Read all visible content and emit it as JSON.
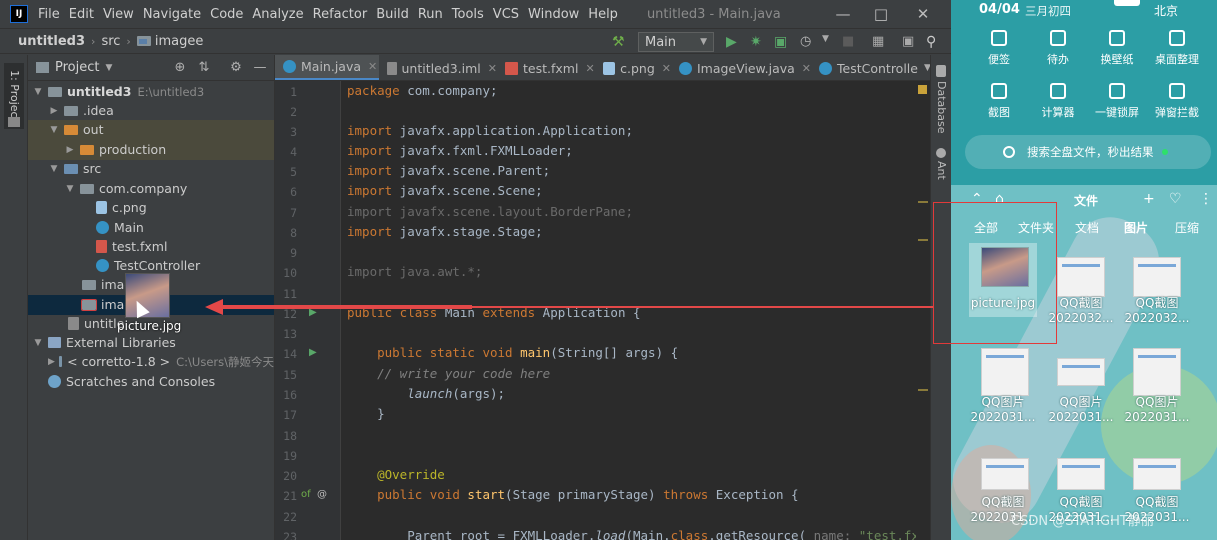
{
  "ide": {
    "logo": "IJ",
    "menu": [
      "File",
      "Edit",
      "View",
      "Navigate",
      "Code",
      "Analyze",
      "Refactor",
      "Build",
      "Run",
      "Tools",
      "VCS",
      "Window",
      "Help"
    ],
    "window_title": "untitled3 - Main.java",
    "breadcrumb": {
      "project": "untitled3",
      "src": "src",
      "folder": "imagee"
    },
    "run_config": "Main",
    "project_panel": {
      "title": "Project",
      "strip_label": "1: Project",
      "tree": [
        {
          "label": "untitled3",
          "path": "E:\\untitled3",
          "bold": true
        },
        {
          "label": ".idea"
        },
        {
          "label": "out"
        },
        {
          "label": "production"
        },
        {
          "label": "src"
        },
        {
          "label": "com.company"
        },
        {
          "label": "c.png"
        },
        {
          "label": "Main"
        },
        {
          "label": "test.fxml"
        },
        {
          "label": "TestController"
        },
        {
          "label": "image"
        },
        {
          "label": "imag"
        },
        {
          "label": "untitle"
        },
        {
          "label": "External Libraries"
        },
        {
          "label": "< corretto-1.8 >",
          "path": "C:\\Users\\静姬今天"
        },
        {
          "label": "Scratches and Consoles"
        }
      ],
      "drag_label": "picture.jpg"
    },
    "tabs": [
      "Main.java",
      "untitled3.iml",
      "test.fxml",
      "c.png",
      "ImageView.java",
      "TestControlle"
    ],
    "right_strip": [
      "Database",
      "Ant"
    ],
    "gutter_marks": {
      "overridden": "of",
      "annotation": "@"
    },
    "line_numbers": [
      "1",
      "2",
      "3",
      "4",
      "5",
      "6",
      "7",
      "8",
      "9",
      "10",
      "11",
      "12",
      "13",
      "14",
      "15",
      "16",
      "17",
      "18",
      "19",
      "20",
      "21",
      "22",
      "23"
    ],
    "code": {
      "l1": [
        "package",
        " com.company;"
      ],
      "l3": [
        "import",
        " javafx.application.Application;"
      ],
      "l4": [
        "import",
        " javafx.fxml.FXMLLoader;"
      ],
      "l5": [
        "import",
        " javafx.scene.Parent;"
      ],
      "l6": [
        "import",
        " javafx.scene.Scene;"
      ],
      "l7": "import javafx.scene.layout.BorderPane;",
      "l8": [
        "import",
        " javafx.stage.Stage;"
      ],
      "l10": "import java.awt.*;",
      "l12": [
        "public class",
        " Main ",
        "extends",
        " Application {"
      ],
      "l14": [
        "    public static void",
        " main",
        "(String[] args) {"
      ],
      "l15": "    // write your code here",
      "l16": [
        "        ",
        "launch",
        "(args);"
      ],
      "l17": "    }",
      "l20": "    @Override",
      "l21": [
        "    public void",
        " start",
        "(Stage primaryStage) ",
        "throws",
        " Exception {"
      ],
      "l23": [
        "        Parent root = FXMLLoader.",
        "load",
        "(Main.",
        "class",
        ".getResource( ",
        "name: ",
        "\"test.fx"
      ]
    }
  },
  "desktop": {
    "date": "04/04",
    "lunar": "三月初四",
    "city": "北京",
    "tiles": [
      "便签",
      "待办",
      "换壁纸",
      "桌面整理",
      "截图",
      "计算器",
      "一键锁屏",
      "弹窗拦截"
    ],
    "search_placeholder": "搜索全盘文件，秒出结果",
    "file_panel": {
      "title": "文件",
      "categories": [
        "全部",
        "文件夹",
        "文档",
        "图片",
        "压缩"
      ],
      "active_category": "图片",
      "files": [
        {
          "name1": "picture.jpg",
          "name2": ""
        },
        {
          "name1": "QQ截图",
          "name2": "2022032..."
        },
        {
          "name1": "QQ截图",
          "name2": "2022032..."
        },
        {
          "name1": "QQ图片",
          "name2": "2022031..."
        },
        {
          "name1": "QQ图片",
          "name2": "2022031..."
        },
        {
          "name1": "QQ图片",
          "name2": "2022031..."
        },
        {
          "name1": "QQ截图",
          "name2": "2022031..."
        },
        {
          "name1": "QQ截图",
          "name2": "2022031..."
        },
        {
          "name1": "QQ截图",
          "name2": "2022031..."
        }
      ]
    },
    "watermark": "CSDN @STATIGHT静丽"
  },
  "colors": {
    "accent": "#4a88c7",
    "arrow": "#e34848",
    "desktop": "#3aa6a8"
  }
}
